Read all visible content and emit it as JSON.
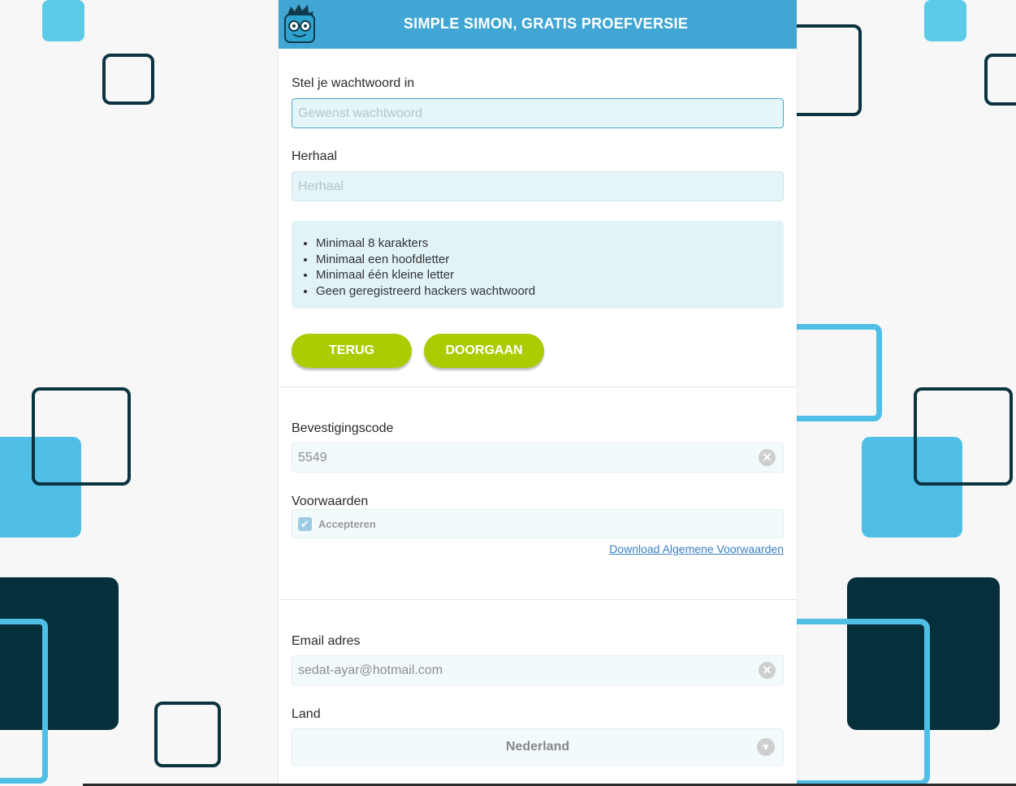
{
  "header": {
    "title": "SIMPLE SIMON, GRATIS PROEFVERSIE",
    "logo_icon": "simple-simon-mascot-icon"
  },
  "password": {
    "label": "Stel je wachtwoord in",
    "placeholder": "Gewenst wachtwoord",
    "value": ""
  },
  "repeat": {
    "label": "Herhaal",
    "placeholder": "Herhaal",
    "value": ""
  },
  "rules": [
    "Minimaal 8 karakters",
    "Minimaal een hoofdletter",
    "Minimaal één kleine letter",
    "Geen geregistreerd hackers wachtwoord"
  ],
  "buttons": {
    "back": "TERUG",
    "continue": "DOORGAAN"
  },
  "confirmation": {
    "label": "Bevestigingscode",
    "value": "5549"
  },
  "terms": {
    "label": "Voorwaarden",
    "checkbox_label": "Accepteren",
    "checked": true,
    "download_link": "Download Algemene Voorwaarden"
  },
  "email": {
    "label": "Email adres",
    "value": "sedat-ayar@hotmail.com"
  },
  "country": {
    "label": "Land",
    "selected": "Nederland"
  },
  "colors": {
    "header": "#42a6d4",
    "button": "#a9cd00",
    "background_light_blue": "#5ccbe7",
    "background_dark": "#062f3c"
  }
}
